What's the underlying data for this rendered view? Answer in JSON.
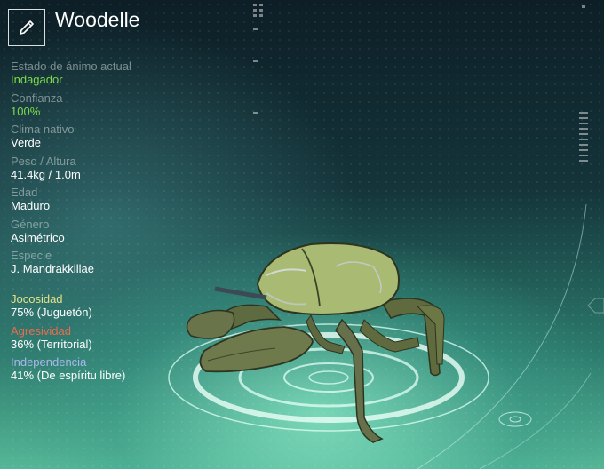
{
  "creature": {
    "name": "Woodelle"
  },
  "stats": [
    {
      "label": "Estado de ánimo actual",
      "value": "Indagador",
      "highlight": true
    },
    {
      "label": "Confianza",
      "value": "100%",
      "highlight": true
    },
    {
      "label": "Clima nativo",
      "value": "Verde",
      "highlight": false
    },
    {
      "label": "Peso / Altura",
      "value": "41.4kg / 1.0m",
      "highlight": false
    },
    {
      "label": "Edad",
      "value": "Maduro",
      "highlight": false
    },
    {
      "label": "Género",
      "value": "Asimétrico",
      "highlight": false
    },
    {
      "label": "Especie",
      "value": "J. Mandrakkillae",
      "highlight": false
    }
  ],
  "personality": [
    {
      "label": "Jocosidad",
      "value": "75% (Juguetón)",
      "color": "#e4e288"
    },
    {
      "label": "Agresividad",
      "value": "36% (Territorial)",
      "color": "#e96c4e"
    },
    {
      "label": "Independencia",
      "value": "41% (De espíritu libre)",
      "color": "#a9b8ee"
    }
  ],
  "icons": {
    "edit": "pencil-icon"
  }
}
